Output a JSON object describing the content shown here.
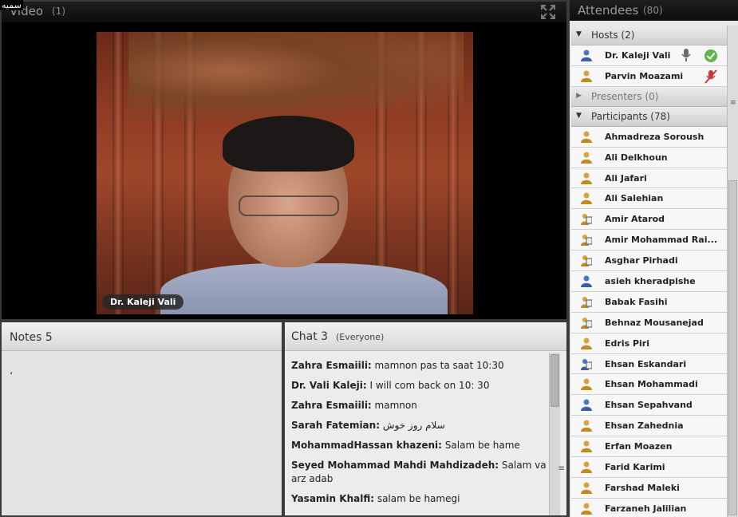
{
  "corner_label": "سمیه",
  "video": {
    "title": "Video",
    "count": "(1)",
    "nameplate": "Dr. Kaleji Vali"
  },
  "notes": {
    "title": "Notes 5",
    "body": "،"
  },
  "chat": {
    "title": "Chat 3",
    "scope": "(Everyone)",
    "messages": [
      {
        "sender": "Zahra Esmaiili:",
        "text": " mamnon pas ta saat 10:30"
      },
      {
        "sender": "Dr. Vali Kaleji:",
        "text": " I will com back on 10: 30"
      },
      {
        "sender": "Zahra Esmaiili:",
        "text": " mamnon"
      },
      {
        "sender": "Sarah Fatemian:",
        "text": " سلام روز خوش"
      },
      {
        "sender": "MohammadHassan khazeni:",
        "text": " Salam be hame"
      },
      {
        "sender": "Seyed Mohammad Mahdi Mahdizadeh:",
        "text": " Salam va arz adab"
      },
      {
        "sender": "Yasamin Khalfi:",
        "text": " salam be hamegi"
      }
    ]
  },
  "attendees": {
    "title": "Attendees",
    "count": "(80)",
    "hosts_label": "Hosts (2)",
    "presenters_label": "Presenters (0)",
    "participants_label": "Participants (78)",
    "hosts": [
      {
        "name": "Dr. Kaleji Vali"
      },
      {
        "name": "Parvin Moazami"
      }
    ],
    "participants": [
      {
        "name": "Ahmadreza Soroush",
        "icon": "user-icon"
      },
      {
        "name": "Ali Delkhoun",
        "icon": "user-icon"
      },
      {
        "name": "Ali Jafari",
        "icon": "user-icon"
      },
      {
        "name": "Ali Salehian",
        "icon": "user-icon"
      },
      {
        "name": "Amir Atarod",
        "icon": "user-screen-icon"
      },
      {
        "name": "Amir Mohammad Rai...",
        "icon": "user-screen-icon"
      },
      {
        "name": "Asghar Pirhadi",
        "icon": "user-screen-icon"
      },
      {
        "name": "asieh kheradpishe",
        "icon": "user-blue-icon"
      },
      {
        "name": "Babak Fasihi",
        "icon": "user-screen-icon"
      },
      {
        "name": "Behnaz Mousanejad",
        "icon": "user-screen-icon"
      },
      {
        "name": "Edris Piri",
        "icon": "user-icon"
      },
      {
        "name": "Ehsan Eskandari",
        "icon": "user-blue-screen-icon"
      },
      {
        "name": "Ehsan Mohammadi",
        "icon": "user-icon"
      },
      {
        "name": "Ehsan Sepahvand",
        "icon": "user-blue-icon"
      },
      {
        "name": "Ehsan Zahednia",
        "icon": "user-icon"
      },
      {
        "name": "Erfan Moazen",
        "icon": "user-icon"
      },
      {
        "name": "Farid Karimi",
        "icon": "user-icon"
      },
      {
        "name": "Farshad Maleki",
        "icon": "user-icon"
      },
      {
        "name": "Farzaneh Jalilian",
        "icon": "user-icon"
      }
    ]
  }
}
